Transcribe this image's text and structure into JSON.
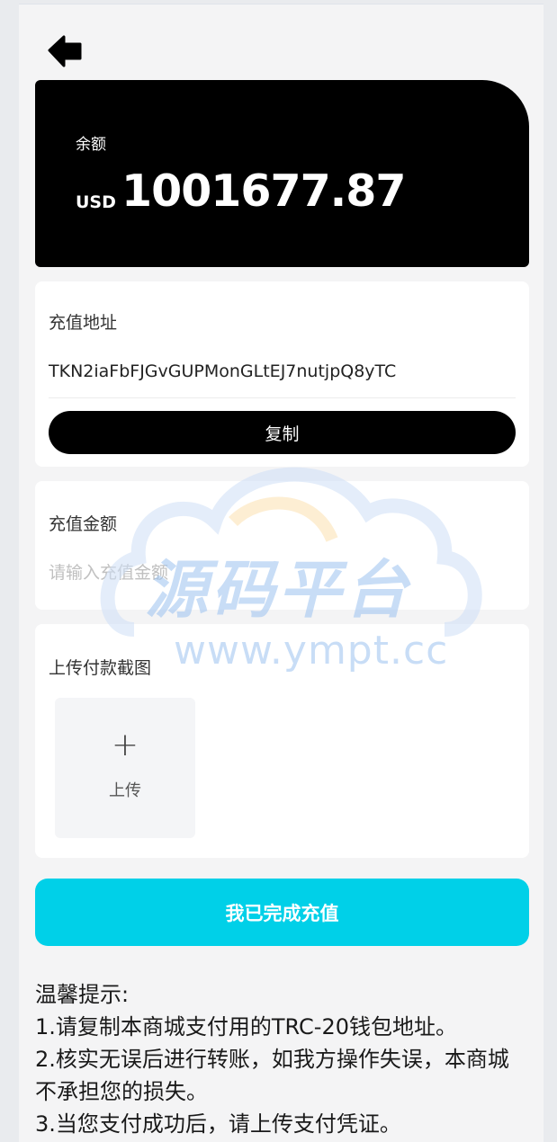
{
  "header": {
    "back_icon": "arrow-left-icon"
  },
  "balance": {
    "label": "余额",
    "currency": "USD",
    "value": "1001677.87"
  },
  "address": {
    "title": "充值地址",
    "value": "TKN2iaFbFJGvGUPMonGLtEJ7nutjpQ8yTC",
    "copy_label": "复制"
  },
  "amount": {
    "title": "充值金额",
    "placeholder": "请输入充值金额"
  },
  "upload": {
    "title": "上传付款截图",
    "plus": "+",
    "label": "上传"
  },
  "submit_label": "我已完成充值",
  "tips": {
    "lines": [
      "温馨提示:",
      "1.请复制本商城支付用的TRC-20钱包地址。",
      "2.核实无误后进行转账，如我方操作失误，本商城不承担您的损失。",
      "3.当您支付成功后，请上传支付凭证。"
    ]
  },
  "watermark": {
    "title": "源码平台",
    "url": "www.ympt.cc"
  },
  "colors": {
    "accent": "#00d0e8",
    "card_dark": "#000000",
    "background": "#f4f4f5"
  }
}
